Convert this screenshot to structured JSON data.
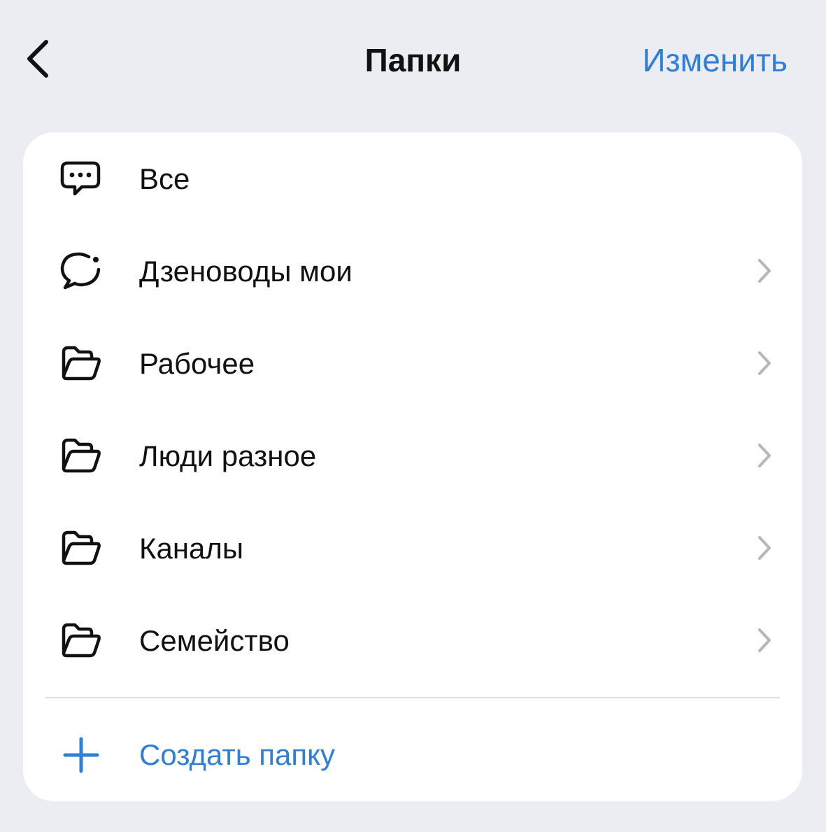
{
  "nav": {
    "back_icon": "chevron-left-icon",
    "title": "Папки",
    "edit_label": "Изменить"
  },
  "folders": {
    "items": [
      {
        "label": "Все",
        "icon": "chat-dots-icon",
        "has_chevron": false
      },
      {
        "label": "Дзеноводы мои",
        "icon": "chat-bubble-icon",
        "has_chevron": true
      },
      {
        "label": "Рабочее",
        "icon": "folder-icon",
        "has_chevron": true
      },
      {
        "label": "Люди разное",
        "icon": "folder-icon",
        "has_chevron": true
      },
      {
        "label": "Каналы",
        "icon": "folder-icon",
        "has_chevron": true
      },
      {
        "label": "Семейство",
        "icon": "folder-icon",
        "has_chevron": true
      }
    ]
  },
  "create": {
    "icon": "plus-icon",
    "label": "Создать папку"
  },
  "colors": {
    "background": "#ebedf2",
    "card": "#ffffff",
    "accent": "#2f7fd6",
    "text": "#111111",
    "chevron": "#b5b7bd",
    "divider": "#dedfe3"
  }
}
